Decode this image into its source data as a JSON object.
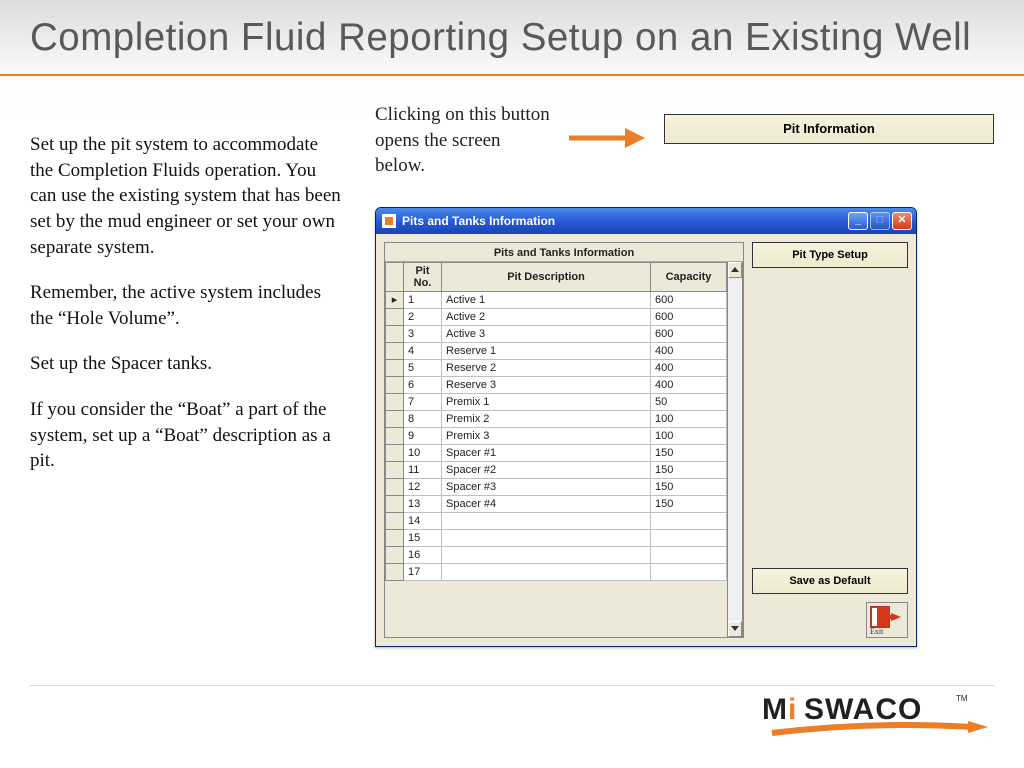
{
  "title": "Completion Fluid Reporting Setup on an Existing Well",
  "left_paragraphs": [
    "Set up the pit system to accommodate the Completion Fluids operation. You can use the existing system that has been set by the mud engineer or set your own separate system.",
    "Remember, the active system includes the “Hole Volume”.",
    "Set up the Spacer tanks.",
    "If you consider the “Boat” a part of the system, set up a “Boat” description as a pit."
  ],
  "callout_text": "Clicking on this button opens the screen below.",
  "pit_info_button": "Pit Information",
  "window": {
    "title": "Pits and Tanks Information",
    "table_title": "Pits and Tanks Information",
    "headers": {
      "pit_no": "Pit No.",
      "desc": "Pit Description",
      "cap": "Capacity"
    },
    "rows": [
      {
        "no": "1",
        "desc": "Active 1",
        "cap": "600"
      },
      {
        "no": "2",
        "desc": "Active 2",
        "cap": "600"
      },
      {
        "no": "3",
        "desc": "Active 3",
        "cap": "600"
      },
      {
        "no": "4",
        "desc": "Reserve 1",
        "cap": "400"
      },
      {
        "no": "5",
        "desc": "Reserve 2",
        "cap": "400"
      },
      {
        "no": "6",
        "desc": "Reserve 3",
        "cap": "400"
      },
      {
        "no": "7",
        "desc": "Premix 1",
        "cap": "50"
      },
      {
        "no": "8",
        "desc": "Premix 2",
        "cap": "100"
      },
      {
        "no": "9",
        "desc": "Premix 3",
        "cap": "100"
      },
      {
        "no": "10",
        "desc": "Spacer #1",
        "cap": "150"
      },
      {
        "no": "11",
        "desc": "Spacer #2",
        "cap": "150"
      },
      {
        "no": "12",
        "desc": "Spacer #3",
        "cap": "150"
      },
      {
        "no": "13",
        "desc": "Spacer #4",
        "cap": "150"
      },
      {
        "no": "14",
        "desc": "",
        "cap": ""
      },
      {
        "no": "15",
        "desc": "",
        "cap": ""
      },
      {
        "no": "16",
        "desc": "",
        "cap": ""
      },
      {
        "no": "17",
        "desc": "",
        "cap": ""
      }
    ],
    "buttons": {
      "pit_type_setup": "Pit Type Setup",
      "save_default": "Save as Default",
      "exit": "Exit"
    }
  },
  "logo": {
    "mi": "Mi",
    "swaco": "SWACO"
  }
}
